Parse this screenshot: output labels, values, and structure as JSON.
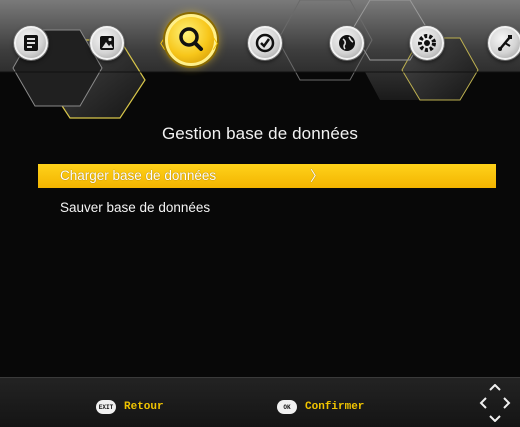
{
  "header": {
    "icons": [
      {
        "name": "tv-list-icon"
      },
      {
        "name": "picture-icon"
      },
      {
        "name": "search-icon",
        "active": true
      },
      {
        "name": "clock-icon"
      },
      {
        "name": "globe-icon"
      },
      {
        "name": "gear-icon"
      },
      {
        "name": "usb-icon"
      }
    ]
  },
  "page": {
    "title": "Gestion base de données"
  },
  "menu": {
    "items": [
      {
        "label": "Charger base de données",
        "selected": true,
        "chevron": "〉"
      },
      {
        "label": "Sauver base de données",
        "selected": false
      }
    ]
  },
  "footer": {
    "exit_key": "EXIT",
    "exit_label": "Retour",
    "ok_key": "OK",
    "ok_label": "Confirmer"
  },
  "colors": {
    "accent": "#f5c400",
    "background": "#080808"
  }
}
